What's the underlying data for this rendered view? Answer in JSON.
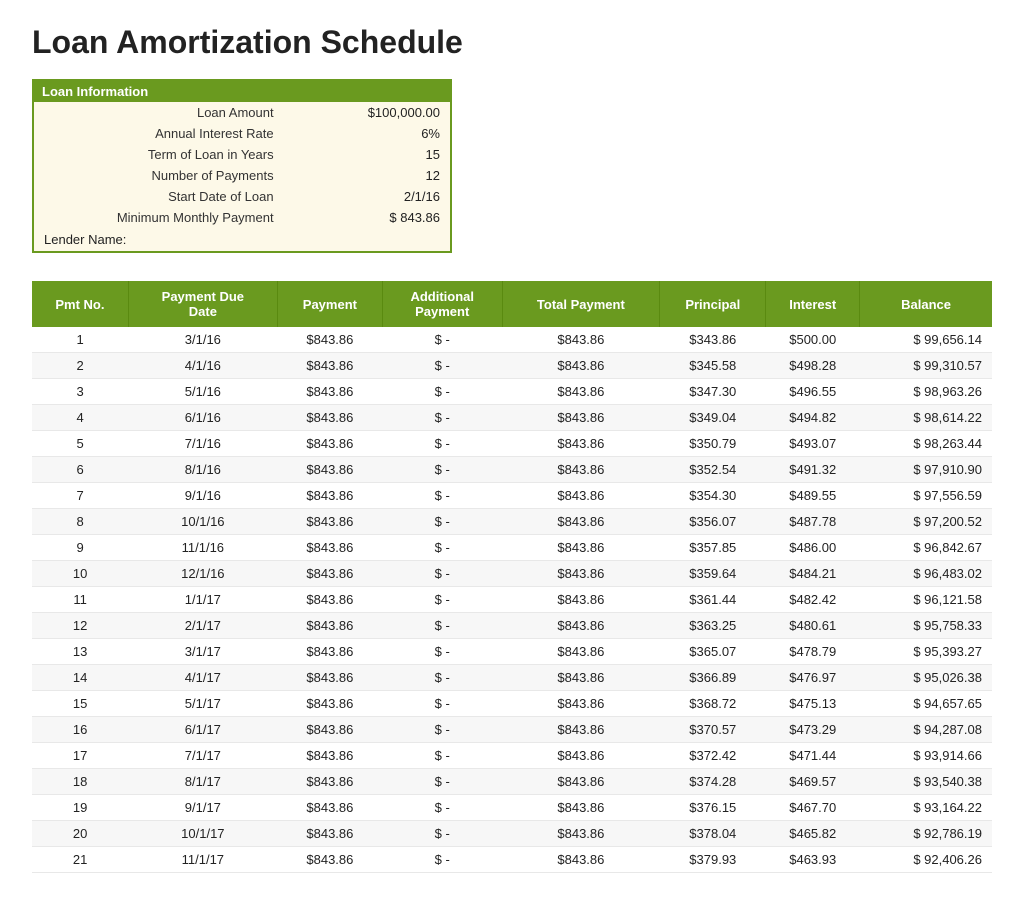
{
  "page": {
    "title": "Loan Amortization Schedule"
  },
  "loanInfo": {
    "header": "Loan Information",
    "fields": [
      {
        "label": "Loan Amount",
        "value": "$100,000.00"
      },
      {
        "label": "Annual Interest Rate",
        "value": "6%"
      },
      {
        "label": "Term of Loan in Years",
        "value": "15"
      },
      {
        "label": "Number of Payments",
        "value": "12"
      },
      {
        "label": "Start Date of Loan",
        "value": "2/1/16"
      },
      {
        "label": "Minimum Monthly Payment",
        "value": "$    843.86"
      }
    ],
    "lenderLabel": "Lender Name:"
  },
  "table": {
    "columns": [
      "Pmt No.",
      "Payment Due Date",
      "Payment",
      "Additional Payment",
      "Total Payment",
      "Principal",
      "Interest",
      "Balance"
    ],
    "rows": [
      {
        "pmt": 1,
        "date": "3/1/16",
        "payment": "$843.86",
        "addlDollar": "$",
        "addlAmt": "-",
        "total": "$843.86",
        "principal": "$343.86",
        "interest": "$500.00",
        "balDollar": "$",
        "balance": "99,656.14"
      },
      {
        "pmt": 2,
        "date": "4/1/16",
        "payment": "$843.86",
        "addlDollar": "$",
        "addlAmt": "-",
        "total": "$843.86",
        "principal": "$345.58",
        "interest": "$498.28",
        "balDollar": "$",
        "balance": "99,310.57"
      },
      {
        "pmt": 3,
        "date": "5/1/16",
        "payment": "$843.86",
        "addlDollar": "$",
        "addlAmt": "-",
        "total": "$843.86",
        "principal": "$347.30",
        "interest": "$496.55",
        "balDollar": "$",
        "balance": "98,963.26"
      },
      {
        "pmt": 4,
        "date": "6/1/16",
        "payment": "$843.86",
        "addlDollar": "$",
        "addlAmt": "-",
        "total": "$843.86",
        "principal": "$349.04",
        "interest": "$494.82",
        "balDollar": "$",
        "balance": "98,614.22"
      },
      {
        "pmt": 5,
        "date": "7/1/16",
        "payment": "$843.86",
        "addlDollar": "$",
        "addlAmt": "-",
        "total": "$843.86",
        "principal": "$350.79",
        "interest": "$493.07",
        "balDollar": "$",
        "balance": "98,263.44"
      },
      {
        "pmt": 6,
        "date": "8/1/16",
        "payment": "$843.86",
        "addlDollar": "$",
        "addlAmt": "-",
        "total": "$843.86",
        "principal": "$352.54",
        "interest": "$491.32",
        "balDollar": "$",
        "balance": "97,910.90"
      },
      {
        "pmt": 7,
        "date": "9/1/16",
        "payment": "$843.86",
        "addlDollar": "$",
        "addlAmt": "-",
        "total": "$843.86",
        "principal": "$354.30",
        "interest": "$489.55",
        "balDollar": "$",
        "balance": "97,556.59"
      },
      {
        "pmt": 8,
        "date": "10/1/16",
        "payment": "$843.86",
        "addlDollar": "$",
        "addlAmt": "-",
        "total": "$843.86",
        "principal": "$356.07",
        "interest": "$487.78",
        "balDollar": "$",
        "balance": "97,200.52"
      },
      {
        "pmt": 9,
        "date": "11/1/16",
        "payment": "$843.86",
        "addlDollar": "$",
        "addlAmt": "-",
        "total": "$843.86",
        "principal": "$357.85",
        "interest": "$486.00",
        "balDollar": "$",
        "balance": "96,842.67"
      },
      {
        "pmt": 10,
        "date": "12/1/16",
        "payment": "$843.86",
        "addlDollar": "$",
        "addlAmt": "-",
        "total": "$843.86",
        "principal": "$359.64",
        "interest": "$484.21",
        "balDollar": "$",
        "balance": "96,483.02"
      },
      {
        "pmt": 11,
        "date": "1/1/17",
        "payment": "$843.86",
        "addlDollar": "$",
        "addlAmt": "-",
        "total": "$843.86",
        "principal": "$361.44",
        "interest": "$482.42",
        "balDollar": "$",
        "balance": "96,121.58"
      },
      {
        "pmt": 12,
        "date": "2/1/17",
        "payment": "$843.86",
        "addlDollar": "$",
        "addlAmt": "-",
        "total": "$843.86",
        "principal": "$363.25",
        "interest": "$480.61",
        "balDollar": "$",
        "balance": "95,758.33"
      },
      {
        "pmt": 13,
        "date": "3/1/17",
        "payment": "$843.86",
        "addlDollar": "$",
        "addlAmt": "-",
        "total": "$843.86",
        "principal": "$365.07",
        "interest": "$478.79",
        "balDollar": "$",
        "balance": "95,393.27"
      },
      {
        "pmt": 14,
        "date": "4/1/17",
        "payment": "$843.86",
        "addlDollar": "$",
        "addlAmt": "-",
        "total": "$843.86",
        "principal": "$366.89",
        "interest": "$476.97",
        "balDollar": "$",
        "balance": "95,026.38"
      },
      {
        "pmt": 15,
        "date": "5/1/17",
        "payment": "$843.86",
        "addlDollar": "$",
        "addlAmt": "-",
        "total": "$843.86",
        "principal": "$368.72",
        "interest": "$475.13",
        "balDollar": "$",
        "balance": "94,657.65"
      },
      {
        "pmt": 16,
        "date": "6/1/17",
        "payment": "$843.86",
        "addlDollar": "$",
        "addlAmt": "-",
        "total": "$843.86",
        "principal": "$370.57",
        "interest": "$473.29",
        "balDollar": "$",
        "balance": "94,287.08"
      },
      {
        "pmt": 17,
        "date": "7/1/17",
        "payment": "$843.86",
        "addlDollar": "$",
        "addlAmt": "-",
        "total": "$843.86",
        "principal": "$372.42",
        "interest": "$471.44",
        "balDollar": "$",
        "balance": "93,914.66"
      },
      {
        "pmt": 18,
        "date": "8/1/17",
        "payment": "$843.86",
        "addlDollar": "$",
        "addlAmt": "-",
        "total": "$843.86",
        "principal": "$374.28",
        "interest": "$469.57",
        "balDollar": "$",
        "balance": "93,540.38"
      },
      {
        "pmt": 19,
        "date": "9/1/17",
        "payment": "$843.86",
        "addlDollar": "$",
        "addlAmt": "-",
        "total": "$843.86",
        "principal": "$376.15",
        "interest": "$467.70",
        "balDollar": "$",
        "balance": "93,164.22"
      },
      {
        "pmt": 20,
        "date": "10/1/17",
        "payment": "$843.86",
        "addlDollar": "$",
        "addlAmt": "-",
        "total": "$843.86",
        "principal": "$378.04",
        "interest": "$465.82",
        "balDollar": "$",
        "balance": "92,786.19"
      },
      {
        "pmt": 21,
        "date": "11/1/17",
        "payment": "$843.86",
        "addlDollar": "$",
        "addlAmt": "-",
        "total": "$843.86",
        "principal": "$379.93",
        "interest": "$463.93",
        "balDollar": "$",
        "balance": "92,406.26"
      }
    ]
  }
}
